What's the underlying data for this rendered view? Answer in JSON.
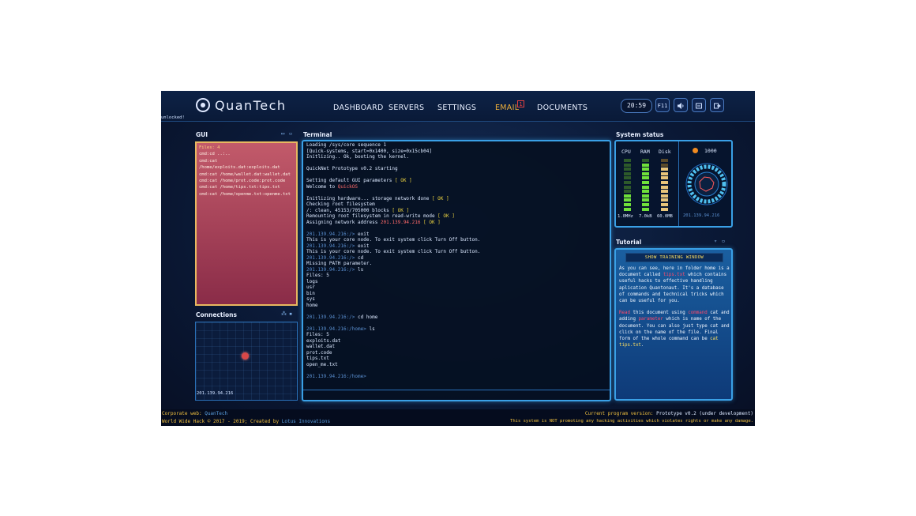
{
  "header": {
    "brand": "QuanTech",
    "nav": [
      "DASHBOARD",
      "SERVERS",
      "SETTINGS",
      "EMAIL",
      "DOCUMENTS"
    ],
    "email_badge": "1",
    "clock": "20:59",
    "f11": "F11",
    "unlocked": "unlocked!"
  },
  "gui_panel": {
    "title": "GUI",
    "lines": [
      "Files: 4",
      "cmd:cd ..:..",
      "cmd:cat",
      "/home/exploits.dat:exploits.dat",
      "cmd:cat /home/wallet.dat:wallet.dat",
      "cmd:cat /home/prot.code:prot.code",
      "cmd:cat /home/tips.txt:tips.txt",
      "cmd:cat /home/openme.txt:openme.txt"
    ]
  },
  "connections": {
    "title": "Connections",
    "ip": "201.139.94.216"
  },
  "terminal": {
    "title": "Terminal",
    "lines": [
      {
        "t": "Loading /sys/core sequence 1"
      },
      {
        "t": "[Quick-systems, start=0x1400, size=0x15cb04]"
      },
      {
        "t": "Initlizing.. Ok, booting the kernel."
      },
      {
        "t": ""
      },
      {
        "t": "QuickNet Prototype v0.2 starting"
      },
      {
        "t": ""
      },
      {
        "t": "Setting default GUI parameters",
        "ok": "[ OK ]"
      },
      {
        "t": "Welcome to",
        "q": "QuickOS"
      },
      {
        "t": ""
      },
      {
        "t": "Initlizing hardware... storage network done",
        "ok": "[ OK ]"
      },
      {
        "t": "Checking root filesystem"
      },
      {
        "t": "/: clean, 45153/705000 blocks",
        "ok": "[ OK ]"
      },
      {
        "t": "Remounting root filesystem in read-write mode",
        "ok": "[ OK ]"
      },
      {
        "t": "Assigning network address",
        "q": "201.139.94.216",
        "ok": "[ OK ]"
      },
      {
        "t": ""
      },
      {
        "ip": "201.139.94.216:/>",
        "t": " exit"
      },
      {
        "t": "This is your core node. To exit system click Turn Off button."
      },
      {
        "ip": "201.139.94.216:/>",
        "t": " exit"
      },
      {
        "t": "This is your core node. To exit system click Turn Off button."
      },
      {
        "ip": "201.139.94.216:/>",
        "t": " cd"
      },
      {
        "t": "Missing PATH parameter."
      },
      {
        "ip": "201.139.94.216:/>",
        "t": " ls"
      },
      {
        "t": "Files: 5"
      },
      {
        "t": "logs"
      },
      {
        "t": "usr"
      },
      {
        "t": "bin"
      },
      {
        "t": "sys"
      },
      {
        "t": "home"
      },
      {
        "t": ""
      },
      {
        "ip": "201.139.94.216:/>",
        "t": " cd home"
      },
      {
        "t": ""
      },
      {
        "ip": "201.139.94.216:/home>",
        "t": " ls"
      },
      {
        "t": "Files: 5"
      },
      {
        "t": "exploits.dat"
      },
      {
        "t": "wallet.dat"
      },
      {
        "t": "prot.code"
      },
      {
        "t": "tips.txt"
      },
      {
        "t": "open_me.txt"
      },
      {
        "t": ""
      },
      {
        "ip": "201.139.94.216:/home>",
        "t": ""
      }
    ]
  },
  "system_status": {
    "title": "System status",
    "labels": [
      "CPU",
      "RAM",
      "Disk"
    ],
    "values": [
      "1.0MHz",
      "7.0kB",
      "60.0MB"
    ],
    "levels": [
      0.35,
      0.95,
      0.8
    ],
    "coins": "1000",
    "ip": "201.139.94.216",
    "bar_colors": {
      "lit": "#6fe03a",
      "dim": "#2d5a2a",
      "disk_lit": "#e8c47a",
      "disk_dim": "#5a4a2a"
    }
  },
  "tutorial": {
    "title": "Tutorial",
    "button": "SHOW TRAINING WINDOW",
    "p1_a": "As you can see, here in folder home is a document called ",
    "p1_b": "tips.txt",
    "p1_c": " which contains useful hacks to effective handling aplication Quantonaut. It's a database of commands and technical tricks which can be useful for you.",
    "p2_a": "Read",
    "p2_b": " this document using ",
    "p2_c": "command",
    "p2_d": " cat and adding ",
    "p2_e": "parameter",
    "p2_f": " which is name of the document. You can also just type cat and click on the name of the file. Final form of the whole command can be ",
    "p2_g": "cat tips.txt",
    "p2_h": "."
  },
  "footer": {
    "corp_label": "Corporate web:",
    "corp_value": "QuanTech",
    "copy_a": "World Wide Hack © 2017 - 2019; Created by",
    "copy_b": "Lotus Innovations",
    "version_label": "Current program version:",
    "version_value": "Prototype v0.2 (under development)",
    "disclaimer": "This system is NOT promoting any hacking activities which violates rights or make any damage."
  }
}
